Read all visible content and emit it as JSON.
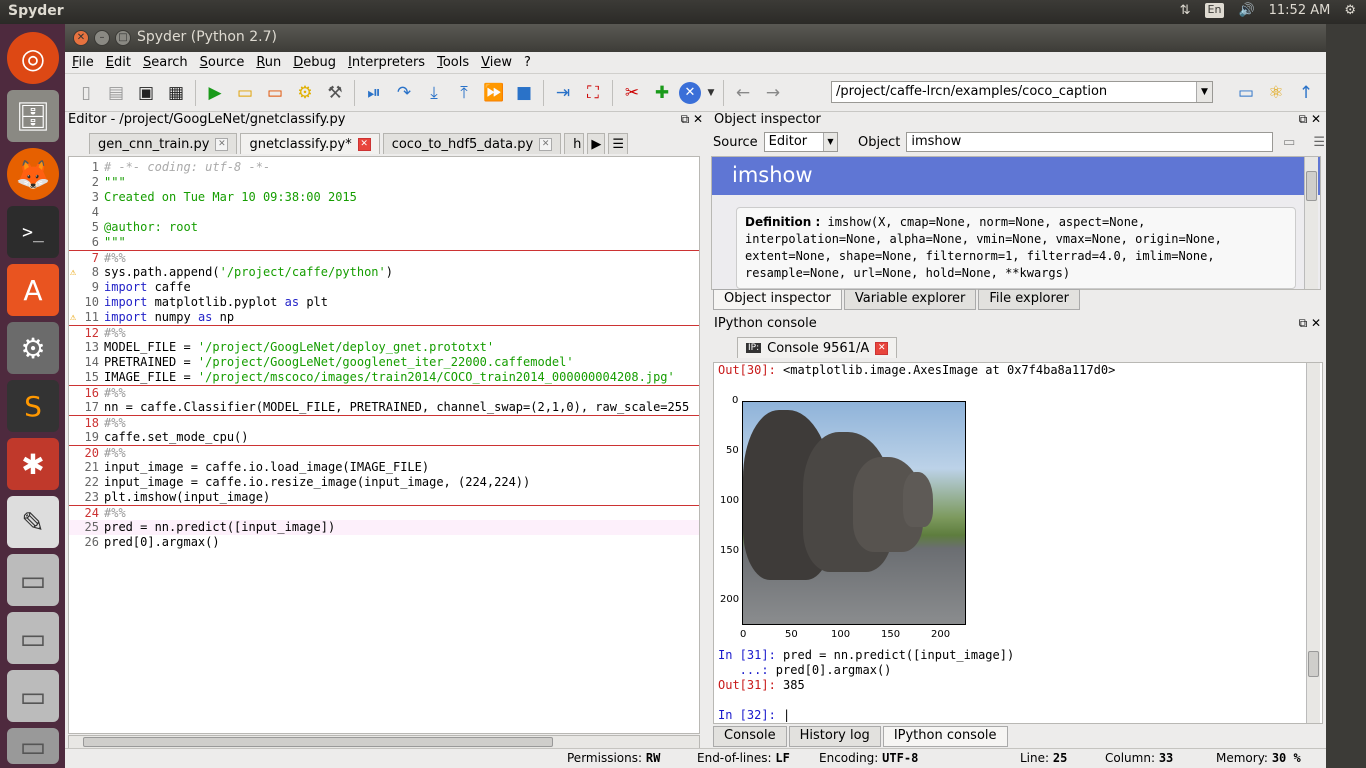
{
  "os": {
    "app_name": "Spyder",
    "lang": "En",
    "clock": "11:52 AM"
  },
  "window": {
    "title": "Spyder (Python 2.7)"
  },
  "menu": [
    "File",
    "Edit",
    "Search",
    "Source",
    "Run",
    "Debug",
    "Interpreters",
    "Tools",
    "View",
    "?"
  ],
  "toolbar": {
    "path": "/project/caffe-lrcn/examples/coco_caption"
  },
  "editor": {
    "title": "Editor - /project/GoogLeNet/gnetclassify.py",
    "tabs": [
      "gen_cnn_train.py",
      "gnetclassify.py*",
      "coco_to_hdf5_data.py",
      "h"
    ],
    "lines": [
      "# -*- coding: utf-8 -*-",
      "\"\"\"",
      "Created on Tue Mar 10 09:38:00 2015",
      "",
      "@author: root",
      "\"\"\"",
      "#%%",
      "sys.path.append('/project/caffe/python')",
      "import caffe",
      "import matplotlib.pyplot as plt",
      "import numpy as np",
      "#%%",
      "MODEL_FILE = '/project/GoogLeNet/deploy_gnet.prototxt'",
      "PRETRAINED = '/project/GoogLeNet/googlenet_iter_22000.caffemodel'",
      "IMAGE_FILE = '/project/mscoco/images/train2014/COCO_train2014_000000004208.jpg'",
      "#%%",
      "nn = caffe.Classifier(MODEL_FILE, PRETRAINED, channel_swap=(2,1,0), raw_scale=255",
      "#%%",
      "caffe.set_mode_cpu()",
      "#%%",
      "input_image = caffe.io.load_image(IMAGE_FILE)",
      "input_image = caffe.io.resize_image(input_image, (224,224))",
      "plt.imshow(input_image)",
      "#%%",
      "pred = nn.predict([input_image])",
      "pred[0].argmax()"
    ]
  },
  "inspector": {
    "title": "Object inspector",
    "source_label": "Source",
    "source_value": "Editor",
    "object_label": "Object",
    "object_value": "imshow",
    "doc_title": "imshow",
    "def_label": "Definition :",
    "def_text": "imshow(X, cmap=None, norm=None, aspect=None, interpolation=None, alpha=None, vmin=None, vmax=None, origin=None, extent=None, shape=None, filternorm=1, filterrad=4.0, imlim=None, resample=None, url=None, hold=None, **kwargs)",
    "tabs": [
      "Object inspector",
      "Variable explorer",
      "File explorer"
    ]
  },
  "console": {
    "title": "IPython console",
    "tab": "Console 9561/A",
    "out30_prompt": "Out[30]:",
    "out30_text": " <matplotlib.image.AxesImage at 0x7f4ba8a117d0>",
    "in31_prompt": "In [31]:",
    "in31_text": " pred = nn.predict([input_image])",
    "cont_prompt": "   ...:",
    "cont_text": " pred[0].argmax()",
    "out31_prompt": "Out[31]:",
    "out31_text": " 385",
    "in32_prompt": "In [32]:",
    "plot_yticks": [
      "0",
      "50",
      "100",
      "150",
      "200"
    ],
    "plot_xticks": [
      "0",
      "50",
      "100",
      "150",
      "200"
    ],
    "tabs": [
      "Console",
      "History log",
      "IPython console"
    ]
  },
  "status": {
    "perm_label": "Permissions:",
    "perm_value": "RW",
    "eol_label": "End-of-lines:",
    "eol_value": "LF",
    "enc_label": "Encoding:",
    "enc_value": "UTF-8",
    "line_label": "Line:",
    "line_value": "25",
    "col_label": "Column:",
    "col_value": "33",
    "mem_label": "Memory:",
    "mem_value": "30 %"
  }
}
